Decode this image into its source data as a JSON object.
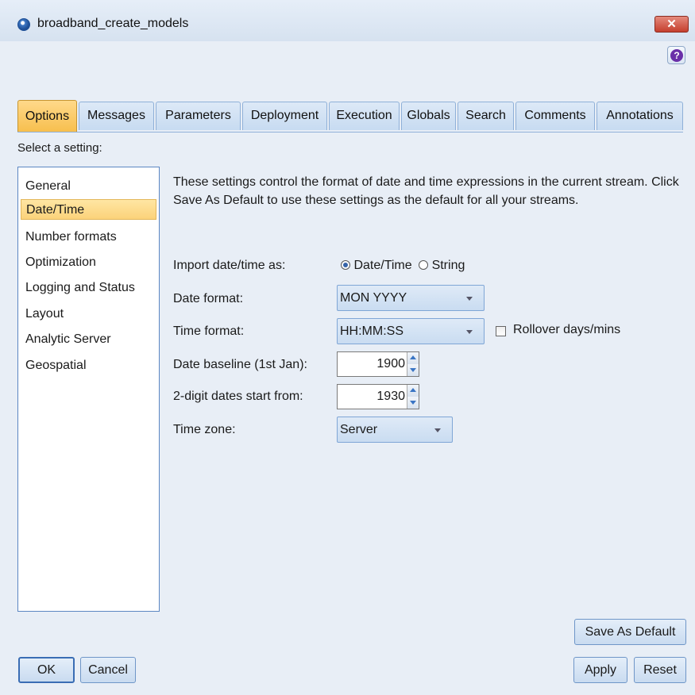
{
  "window": {
    "title": "broadband_create_models",
    "close_glyph": "✕",
    "help_glyph": "?"
  },
  "tabs": [
    {
      "label": "Options",
      "active": true
    },
    {
      "label": "Messages"
    },
    {
      "label": "Parameters"
    },
    {
      "label": "Deployment"
    },
    {
      "label": "Execution"
    },
    {
      "label": "Globals"
    },
    {
      "label": "Search"
    },
    {
      "label": "Comments"
    },
    {
      "label": "Annotations"
    }
  ],
  "settings_prompt": "Select a setting:",
  "settings_list": [
    {
      "label": "General"
    },
    {
      "label": "Date/Time",
      "selected": true
    },
    {
      "label": "Number formats"
    },
    {
      "label": "Optimization"
    },
    {
      "label": "Logging and Status"
    },
    {
      "label": "Layout"
    },
    {
      "label": "Analytic Server"
    },
    {
      "label": "Geospatial"
    }
  ],
  "description": "These settings control the format of date and time expressions in the current stream. Click Save As Default to use these settings as the default for all your streams.",
  "form": {
    "import_label": "Import date/time as:",
    "import_options": [
      "Date/Time",
      "String"
    ],
    "import_selected": "Date/Time",
    "date_format_label": "Date format:",
    "date_format_value": "MON YYYY",
    "time_format_label": "Time format:",
    "time_format_value": "HH:MM:SS",
    "rollover_label": "Rollover days/mins",
    "rollover_checked": false,
    "date_baseline_label": "Date baseline (1st Jan):",
    "date_baseline_value": "1900",
    "two_digit_label": "2-digit dates start from:",
    "two_digit_value": "1930",
    "time_zone_label": "Time zone:",
    "time_zone_value": "Server"
  },
  "buttons": {
    "save_default": "Save As Default",
    "ok": "OK",
    "cancel": "Cancel",
    "apply": "Apply",
    "reset": "Reset"
  },
  "colors": {
    "active_tab": "#f7bf4e",
    "selected_item": "#fbd27a",
    "close": "#c53f2e",
    "help": "#6a2fa8"
  }
}
